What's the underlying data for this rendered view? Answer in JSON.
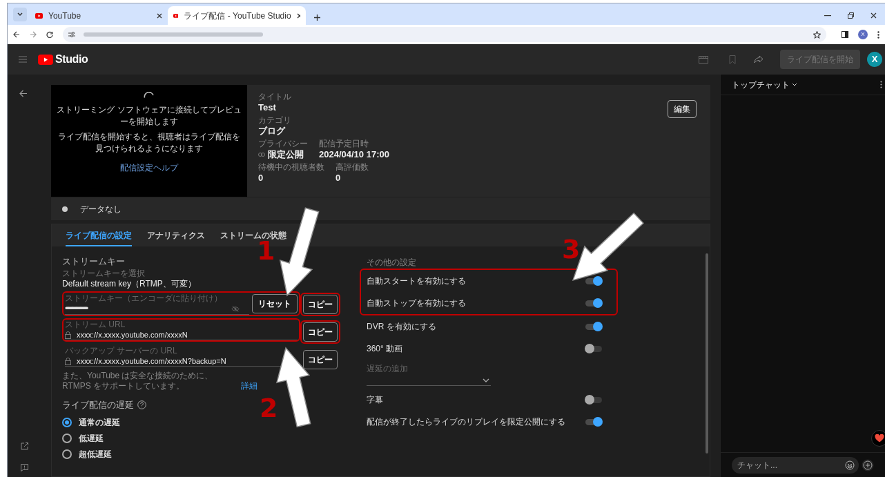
{
  "browser": {
    "tabs": [
      {
        "title": "YouTube",
        "selected": false
      },
      {
        "title": "ライブ配信 - YouTube Studio",
        "selected": true
      }
    ],
    "profile_initial": "X"
  },
  "header": {
    "logo_text": "Studio",
    "start_button": {
      "label": "ライブ配信を開始",
      "disabled": true
    },
    "avatar_initial": "X"
  },
  "preview": {
    "message": "ストリーミング ソフトウェアに接続してプレビューを開始します",
    "note": "ライブ配信を開始すると、視聴者はライブ配信を見つけられるようになります",
    "help_link": "配信設定ヘルプ"
  },
  "details": {
    "edit_button": "編集",
    "rows": [
      [
        {
          "label": "タイトル",
          "value": "Test"
        }
      ],
      [
        {
          "label": "カテゴリ",
          "value": "ブログ"
        }
      ],
      [
        {
          "label": "プライバシー",
          "value": "限定公開",
          "kind": "privacy"
        },
        {
          "label": "配信予定日時",
          "value": "2024/04/10 17:00"
        }
      ],
      [
        {
          "label": "待機中の視聴者数",
          "value": "0"
        },
        {
          "label": "高評価数",
          "value": "0"
        }
      ]
    ]
  },
  "status": {
    "text": "データなし"
  },
  "tabs": [
    {
      "label": "ライブ配信の設定",
      "selected": true
    },
    {
      "label": "アナリティクス",
      "selected": false
    },
    {
      "label": "ストリームの状態",
      "selected": false
    }
  ],
  "stream_key": {
    "heading": "ストリームキー",
    "select_label": "ストリームキーを選択",
    "select_value": "Default stream key（RTMP、可変）",
    "key_field": {
      "label": "ストリームキー（エンコーダに貼り付け）",
      "value": "••••••••••••••••••••••••••",
      "highlighted": true
    },
    "reset_button": "リセット",
    "url_fields": [
      {
        "label": "ストリーム URL",
        "value": "xxxx://x.xxxx.youtube.com/xxxxN",
        "highlighted": true
      },
      {
        "label": "バックアップ サーバーの URL",
        "value": "xxxx://x.xxxx.youtube.com/xxxxN?backup=N",
        "highlighted": false
      }
    ],
    "copy_buttons": [
      {
        "label": "コピー",
        "highlighted": true
      },
      {
        "label": "コピー",
        "highlighted": true
      },
      {
        "label": "コピー",
        "highlighted": false
      }
    ],
    "note": "また、YouTube は安全な接続のために、RTMPS をサポートしています。",
    "note_link": "詳細"
  },
  "latency": {
    "heading": "ライブ配信の遅延",
    "options": [
      {
        "label": "通常の遅延",
        "selected": true
      },
      {
        "label": "低遅延",
        "selected": false
      },
      {
        "label": "超低遅延",
        "selected": false
      }
    ]
  },
  "other_settings": {
    "heading": "その他の設定",
    "items": [
      {
        "kind": "toggle",
        "label": "自動スタートを有効にする",
        "on": true,
        "highlighted": true
      },
      {
        "kind": "toggle",
        "label": "自動ストップを有効にする",
        "on": true,
        "highlighted": true
      },
      {
        "kind": "toggle",
        "label": "DVR を有効にする",
        "on": true,
        "highlighted": false
      },
      {
        "kind": "toggle",
        "label": "360° 動画",
        "on": false,
        "highlighted": false
      },
      {
        "kind": "dropdown",
        "label": "遅延の追加",
        "highlighted": false
      },
      {
        "kind": "toggle",
        "label": "字幕",
        "on": false,
        "highlighted": false
      },
      {
        "kind": "toggle",
        "label": "配信が終了したらライブのリプレイを限定公開にする",
        "on": true,
        "highlighted": false
      }
    ]
  },
  "chat": {
    "header": "トップチャット",
    "placeholder": "チャット..."
  },
  "annotations": [
    {
      "number": "1"
    },
    {
      "number": "2"
    },
    {
      "number": "3"
    }
  ]
}
